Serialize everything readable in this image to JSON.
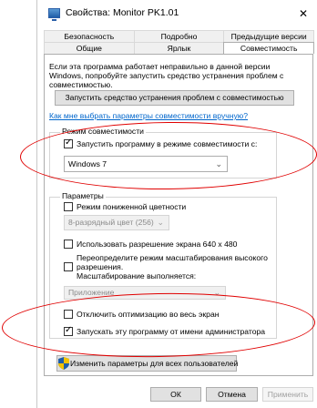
{
  "window": {
    "title": "Свойства: Monitor PK1.01",
    "close_glyph": "✕"
  },
  "tabs": {
    "row1": [
      "Безопасность",
      "Подробно",
      "Предыдущие версии"
    ],
    "row2": [
      "Общие",
      "Ярлык",
      "Совместимость"
    ],
    "active": "Совместимость"
  },
  "intro_text": "Если эта программа работает неправильно в данной версии Windows, попробуйте запустить средство устранения проблем с совместимостью.",
  "troubleshoot_button": "Запустить средство устранения проблем с совместимостью",
  "manual_link": "Как мне выбрать параметры совместимости вручную?",
  "compat_mode": {
    "group_label": "Режим совместимости",
    "checkbox_label": "Запустить программу в режиме совместимости с:",
    "checked": true,
    "selected_os": "Windows 7"
  },
  "settings": {
    "group_label": "Параметры",
    "reduced_color": {
      "label": "Режим пониженной цветности",
      "checked": false
    },
    "color_select": "8-разрядный цвет (256)",
    "resolution_640": {
      "label": "Использовать разрешение экрана 640 x 480",
      "checked": false
    },
    "scaling": {
      "label_line1": "Переопределите режим масштабирования высокого",
      "label_line2": "разрешения.",
      "label_line3": "Масштабирование выполняется:",
      "checked": false
    },
    "scaling_select": "Приложение",
    "disable_fullscreen_opt": {
      "label": "Отключить оптимизацию во весь экран",
      "checked": false
    },
    "run_as_admin": {
      "label": "Запускать эту программу от имени администратора",
      "checked": true
    }
  },
  "all_users_button": "Изменить параметры для всех пользователей",
  "buttons": {
    "ok": "ОК",
    "cancel": "Отмена",
    "apply": "Применить"
  },
  "colors": {
    "annotation": "#e00000",
    "link": "#0066cc",
    "shield_blue": "#1f5ea8",
    "shield_yellow": "#f2c200"
  },
  "icons": {
    "title": "monitor-app-icon",
    "chevron": "chevron-down-icon",
    "shield": "uac-shield-icon"
  }
}
